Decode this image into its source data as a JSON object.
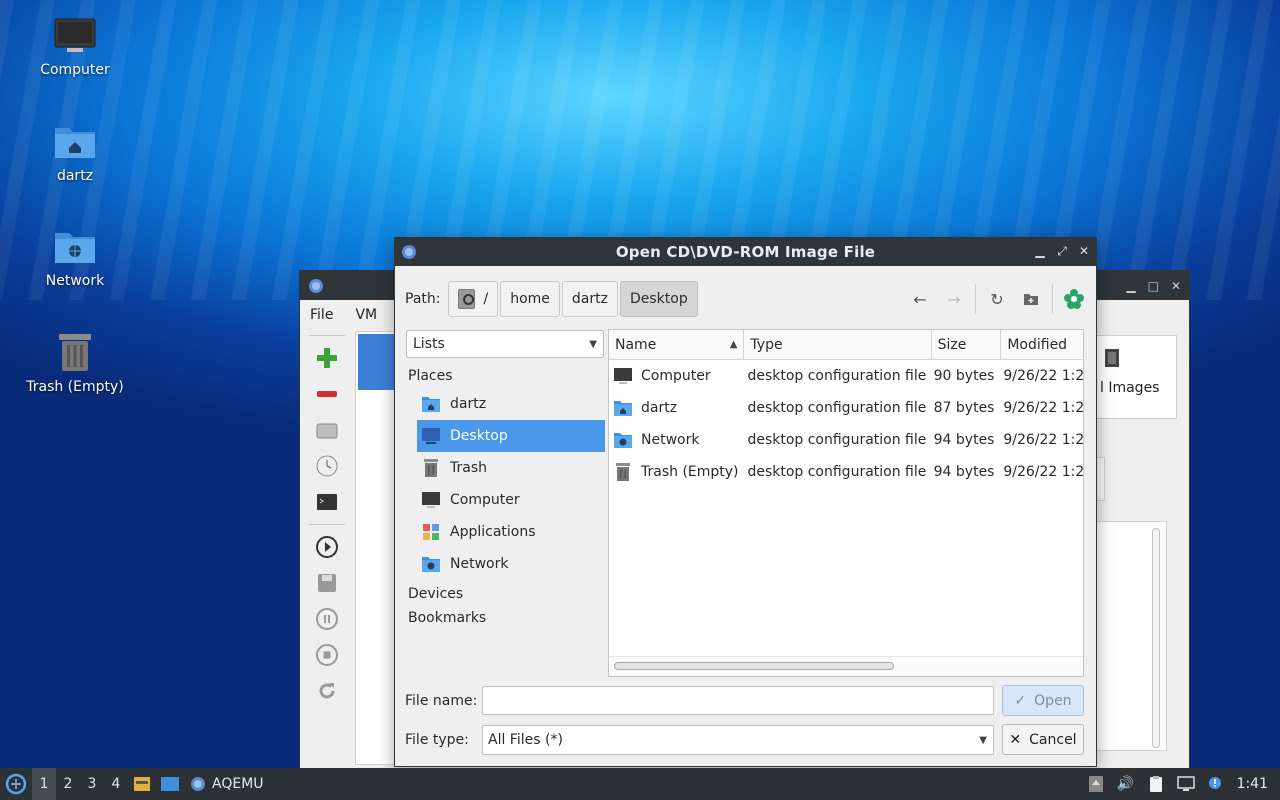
{
  "desktop": {
    "icons": [
      {
        "label": "Computer"
      },
      {
        "label": "dartz"
      },
      {
        "label": "Network"
      },
      {
        "label": "Trash (Empty)"
      }
    ]
  },
  "bg_window": {
    "menu": [
      "File",
      "VM"
    ],
    "right_panel_label": "l Images"
  },
  "dialog": {
    "title": "Open CD\\DVD-ROM Image File",
    "path_label": "Path:",
    "crumbs": [
      "/",
      "home",
      "dartz",
      "Desktop"
    ],
    "lists_combo": "Lists",
    "sections": {
      "places": "Places",
      "devices": "Devices",
      "bookmarks": "Bookmarks"
    },
    "places": [
      {
        "label": "dartz",
        "icon": "home-folder-icon"
      },
      {
        "label": "Desktop",
        "icon": "desktop-icon"
      },
      {
        "label": "Trash",
        "icon": "trash-icon"
      },
      {
        "label": "Computer",
        "icon": "computer-icon"
      },
      {
        "label": "Applications",
        "icon": "applications-icon"
      },
      {
        "label": "Network",
        "icon": "network-folder-icon"
      }
    ],
    "columns": {
      "name": "Name",
      "type": "Type",
      "size": "Size",
      "modified": "Modified"
    },
    "files": [
      {
        "name": "Computer",
        "type": "desktop configuration file",
        "size": "90 bytes",
        "modified": "9/26/22 1:2"
      },
      {
        "name": "dartz",
        "type": "desktop configuration file",
        "size": "87 bytes",
        "modified": "9/26/22 1:2"
      },
      {
        "name": "Network",
        "type": "desktop configuration file",
        "size": "94 bytes",
        "modified": "9/26/22 1:2"
      },
      {
        "name": "Trash (Empty)",
        "type": "desktop configuration file",
        "size": "94 bytes",
        "modified": "9/26/22 1:2"
      }
    ],
    "file_name_label": "File name:",
    "file_name_value": "",
    "file_type_label": "File type:",
    "file_type_value": "All Files (*)",
    "open_button": "Open",
    "cancel_button": "Cancel",
    "selected_place_color": "#4a98ec"
  },
  "taskbar": {
    "workspaces": [
      "1",
      "2",
      "3",
      "4"
    ],
    "task_label": "AQEMU",
    "clock": "1:41"
  }
}
